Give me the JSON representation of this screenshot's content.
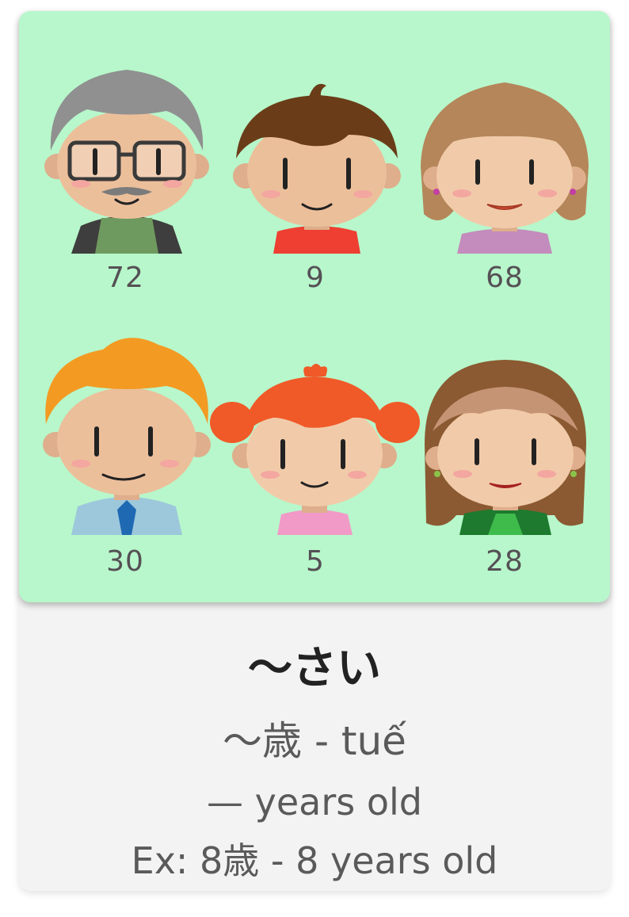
{
  "people": [
    {
      "age": "72",
      "avatar": "grandfather-avatar"
    },
    {
      "age": "9",
      "avatar": "boy-avatar"
    },
    {
      "age": "68",
      "avatar": "grandmother-avatar"
    },
    {
      "age": "30",
      "avatar": "man-avatar"
    },
    {
      "age": "5",
      "avatar": "girl-avatar"
    },
    {
      "age": "28",
      "avatar": "woman-avatar"
    }
  ],
  "vocab": {
    "kana": "〜さい",
    "kanji": "〜歳 - tuế",
    "meaning": "— years old",
    "example": "Ex: 8歳 - 8 years old"
  },
  "colors": {
    "panel": "#b7f7cb",
    "card": "#f3f3f3",
    "skin": "#ecbf9b"
  }
}
